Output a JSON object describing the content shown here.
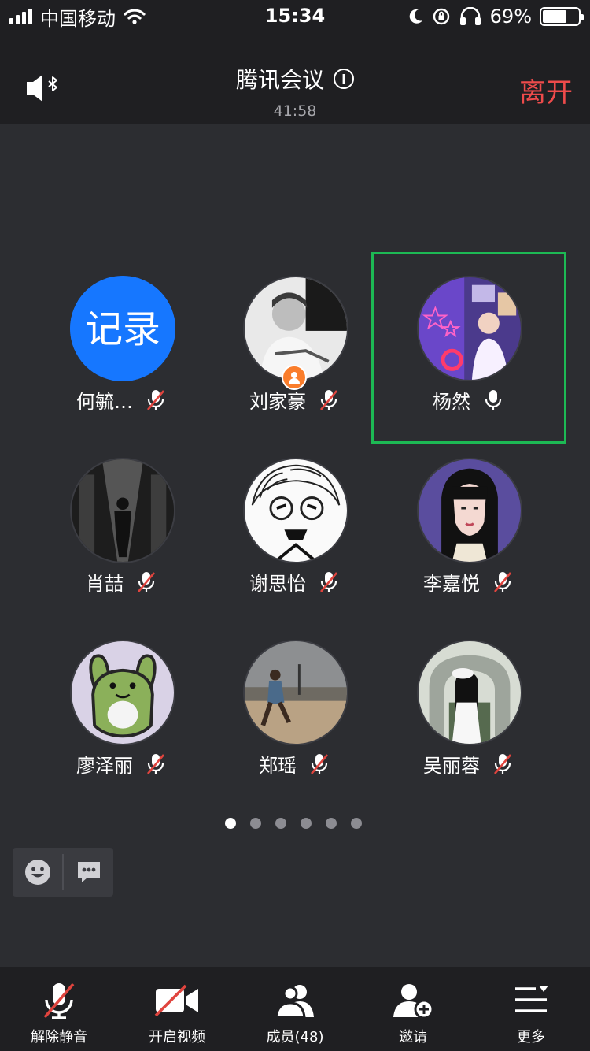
{
  "status_bar": {
    "carrier": "中国移动",
    "time": "15:34",
    "battery": "69%",
    "battery_level": 0.69
  },
  "header": {
    "title": "腾讯会议",
    "duration": "41:58",
    "leave_label": "离开"
  },
  "participants": [
    {
      "name": "何毓…",
      "avatar_text": "记录",
      "muted": true
    },
    {
      "name": "刘家豪",
      "muted": true,
      "host": true
    },
    {
      "name": "杨然",
      "muted": false,
      "speaking": true
    },
    {
      "name": "肖喆",
      "muted": true
    },
    {
      "name": "谢思怡",
      "muted": true
    },
    {
      "name": "李嘉悦",
      "muted": true
    },
    {
      "name": "廖泽丽",
      "muted": true
    },
    {
      "name": "郑瑶",
      "muted": true
    },
    {
      "name": "吴丽蓉",
      "muted": true
    }
  ],
  "pager": {
    "pages": 6,
    "current": 1
  },
  "toolbar": {
    "unmute": "解除静音",
    "video": "开启视频",
    "members": "成员(48)",
    "invite": "邀请",
    "more": "更多"
  },
  "colors": {
    "background": "#2c2d31",
    "bar": "#1f1f22",
    "leave": "#ee4b4b",
    "active_speaker": "#1db954",
    "mute_slash": "#e0443e",
    "record_avatar": "#1677ff"
  }
}
